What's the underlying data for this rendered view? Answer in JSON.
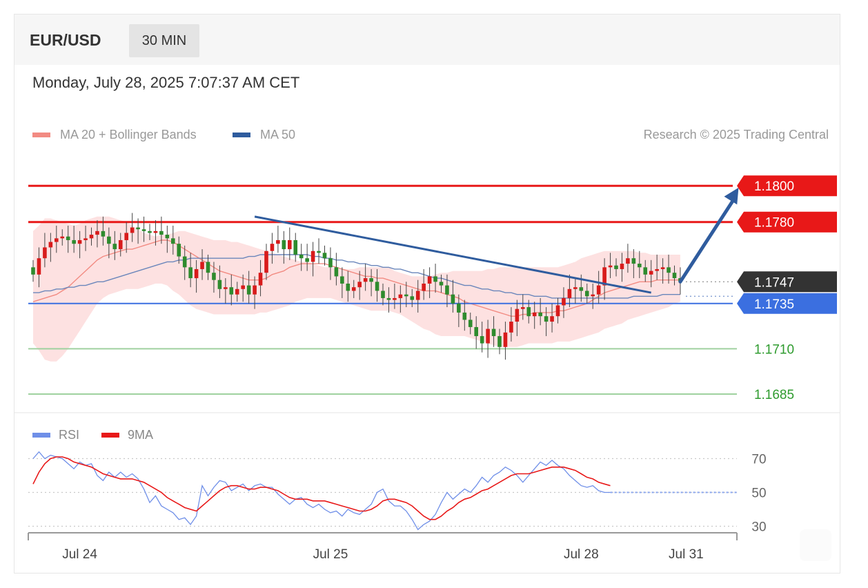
{
  "header": {
    "symbol": "EUR/USD",
    "timeframe": "30 MIN"
  },
  "datetime": "Monday, July 28, 2025 7:07:37 AM CET",
  "legend": {
    "items": [
      {
        "label": "MA 20 + Bollinger Bands",
        "color": "#f28b82"
      },
      {
        "label": "MA 50",
        "color": "#2f5c9e"
      }
    ],
    "copyright": "Research © 2025 Trading Central"
  },
  "rsi_legend": {
    "items": [
      {
        "label": "RSI",
        "color": "#6f8fe8"
      },
      {
        "label": "9MA",
        "color": "#e81818"
      }
    ]
  },
  "colors": {
    "up": "#d81b1b",
    "down": "#2e8b2e",
    "resistance": "#e81818",
    "support": "#3b6fe0",
    "target": "#2f5c9e",
    "current": "#333333"
  },
  "chart_data": [
    {
      "type": "candlestick",
      "title": "EUR/USD",
      "ylim": [
        1.1677,
        1.1818
      ],
      "levels": [
        {
          "label": "1.1800",
          "value": 1.18,
          "kind": "resistance"
        },
        {
          "label": "1.1780",
          "value": 1.178,
          "kind": "resistance"
        },
        {
          "label": "1.1747",
          "value": 1.1747,
          "kind": "current"
        },
        {
          "label": "1.1735",
          "value": 1.1735,
          "kind": "pivot"
        },
        {
          "label": "1.1710",
          "value": 1.171,
          "kind": "support"
        },
        {
          "label": "1.1685",
          "value": 1.1685,
          "kind": "support"
        }
      ],
      "x_ticks": [
        {
          "label": "Jul 24",
          "index": 8
        },
        {
          "label": "Jul 25",
          "index": 51
        },
        {
          "label": "Jul 28",
          "index": 94
        },
        {
          "label": "Jul 31",
          "index": 112
        }
      ],
      "closes": [
        1.1751,
        1.176,
        1.1766,
        1.1769,
        1.1771,
        1.1772,
        1.177,
        1.1768,
        1.177,
        1.1771,
        1.1773,
        1.1775,
        1.1772,
        1.1768,
        1.1765,
        1.177,
        1.1774,
        1.1777,
        1.1776,
        1.1775,
        1.1774,
        1.1775,
        1.1773,
        1.1771,
        1.1768,
        1.1761,
        1.1755,
        1.1749,
        1.1754,
        1.1758,
        1.1752,
        1.1748,
        1.1743,
        1.1744,
        1.174,
        1.1743,
        1.1745,
        1.174,
        1.1745,
        1.1752,
        1.1764,
        1.1768,
        1.177,
        1.1765,
        1.177,
        1.1762,
        1.176,
        1.1758,
        1.1764,
        1.1763,
        1.176,
        1.1755,
        1.175,
        1.1746,
        1.1742,
        1.1744,
        1.1747,
        1.1749,
        1.1747,
        1.1742,
        1.1738,
        1.1737,
        1.1738,
        1.174,
        1.1739,
        1.1737,
        1.1742,
        1.1746,
        1.175,
        1.1747,
        1.1745,
        1.174,
        1.1735,
        1.173,
        1.1726,
        1.1722,
        1.1717,
        1.1713,
        1.1721,
        1.1717,
        1.1711,
        1.1719,
        1.1725,
        1.1732,
        1.1733,
        1.1728,
        1.173,
        1.1728,
        1.1725,
        1.1728,
        1.1734,
        1.1738,
        1.1743,
        1.1744,
        1.1742,
        1.1739,
        1.174,
        1.1745,
        1.1755,
        1.1756,
        1.1754,
        1.1757,
        1.176,
        1.1757,
        1.1755,
        1.1751,
        1.1753,
        1.1754,
        1.1755,
        1.1752,
        1.1749,
        1.1747
      ],
      "ma20_upper": [
        1.1775,
        1.1778,
        1.1782,
        1.1782,
        1.1781,
        1.178,
        1.1779,
        1.1778,
        1.1779,
        1.1781,
        1.1782,
        1.1783,
        1.1783,
        1.1783,
        1.1782,
        1.1781,
        1.178,
        1.1778,
        1.1776,
        1.1774,
        1.1773,
        1.1772,
        1.1773,
        1.1773,
        1.1774,
        1.1775,
        1.1775,
        1.1774,
        1.1773,
        1.1772,
        1.1771,
        1.177,
        1.177,
        1.177,
        1.1769,
        1.1769,
        1.1768,
        1.1767,
        1.1766,
        1.1765,
        1.1764,
        1.1763,
        1.1762,
        1.1761,
        1.176,
        1.1759,
        1.1758,
        1.1758,
        1.1757,
        1.1756,
        1.1755,
        1.1755,
        1.1754,
        1.1754,
        1.1754,
        1.1754,
        1.1755,
        1.1755,
        1.1755,
        1.1755,
        1.1755,
        1.1755,
        1.1753,
        1.1752,
        1.1751,
        1.175,
        1.175,
        1.175,
        1.175,
        1.1751,
        1.1752,
        1.1752,
        1.1753,
        1.1753,
        1.1753,
        1.1753,
        1.1753,
        1.1753,
        1.1754,
        1.1754,
        1.1755,
        1.1755,
        1.1755,
        1.1755,
        1.1755,
        1.1755,
        1.1755,
        1.1755,
        1.1755,
        1.1755,
        1.1755,
        1.1756,
        1.1757,
        1.1758,
        1.176,
        1.1761,
        1.1762,
        1.1763,
        1.1764,
        1.1764,
        1.1764,
        1.1764,
        1.1764,
        1.1764,
        1.1763,
        1.1763,
        1.1762,
        1.1762,
        1.1762,
        1.1762,
        1.1762,
        1.1762
      ],
      "ma20_lower": [
        1.1713,
        1.1709,
        1.1704,
        1.1703,
        1.1703,
        1.1706,
        1.171,
        1.1715,
        1.172,
        1.1725,
        1.173,
        1.1735,
        1.1738,
        1.174,
        1.1741,
        1.1742,
        1.1743,
        1.1743,
        1.1743,
        1.1744,
        1.1745,
        1.1746,
        1.1746,
        1.1745,
        1.1742,
        1.174,
        1.1737,
        1.1734,
        1.1732,
        1.1731,
        1.173,
        1.1729,
        1.1729,
        1.1729,
        1.1729,
        1.1729,
        1.1729,
        1.1729,
        1.1729,
        1.173,
        1.173,
        1.1731,
        1.1732,
        1.1733,
        1.1734,
        1.1736,
        1.1737,
        1.1738,
        1.1738,
        1.1738,
        1.1738,
        1.1738,
        1.1737,
        1.1736,
        1.1735,
        1.1734,
        1.1733,
        1.1732,
        1.1731,
        1.1731,
        1.1731,
        1.1731,
        1.173,
        1.1729,
        1.1727,
        1.1725,
        1.1723,
        1.1721,
        1.172,
        1.1718,
        1.1717,
        1.1717,
        1.1717,
        1.1717,
        1.1717,
        1.1716,
        1.1715,
        1.1714,
        1.1713,
        1.1712,
        1.1711,
        1.1711,
        1.1711,
        1.1711,
        1.1712,
        1.1713,
        1.1713,
        1.1713,
        1.1713,
        1.1713,
        1.1714,
        1.1714,
        1.1714,
        1.1715,
        1.1716,
        1.1717,
        1.1718,
        1.1719,
        1.1721,
        1.1722,
        1.1723,
        1.1724,
        1.1726,
        1.1727,
        1.1728,
        1.1729,
        1.173,
        1.1731,
        1.1732,
        1.1733,
        1.1735,
        1.1736
      ],
      "ma20": [
        1.1736,
        1.1737,
        1.1738,
        1.1739,
        1.174,
        1.1742,
        1.1744,
        1.1747,
        1.175,
        1.1753,
        1.1756,
        1.1759,
        1.1761,
        1.1762,
        1.1763,
        1.1764,
        1.1765,
        1.1765,
        1.1766,
        1.1767,
        1.1768,
        1.1769,
        1.177,
        1.177,
        1.1769,
        1.1767,
        1.1765,
        1.1763,
        1.1761,
        1.1759,
        1.1757,
        1.1755,
        1.1753,
        1.1752,
        1.1751,
        1.175,
        1.1749,
        1.1748,
        1.1748,
        1.1748,
        1.1749,
        1.1751,
        1.1752,
        1.1753,
        1.1755,
        1.1756,
        1.1757,
        1.1757,
        1.1757,
        1.1757,
        1.1757,
        1.1756,
        1.1755,
        1.1754,
        1.1753,
        1.1752,
        1.1751,
        1.175,
        1.175,
        1.1749,
        1.1749,
        1.1748,
        1.1747,
        1.1746,
        1.1745,
        1.1744,
        1.1743,
        1.1742,
        1.1742,
        1.1742,
        1.1741,
        1.174,
        1.1739,
        1.1738,
        1.1736,
        1.1735,
        1.1734,
        1.1733,
        1.1732,
        1.1731,
        1.173,
        1.1729,
        1.1728,
        1.1728,
        1.1729,
        1.1729,
        1.173,
        1.173,
        1.173,
        1.173,
        1.1731,
        1.1731,
        1.1732,
        1.1733,
        1.1734,
        1.1735,
        1.1737,
        1.1739,
        1.1741,
        1.1742,
        1.1743,
        1.1744,
        1.1745,
        1.1746,
        1.1747,
        1.1747,
        1.1747,
        1.1748,
        1.1748,
        1.1748,
        1.1748,
        1.1748
      ],
      "ma50": [
        1.1741,
        1.1741,
        1.1742,
        1.1742,
        1.1743,
        1.1743,
        1.1744,
        1.1744,
        1.1745,
        1.1745,
        1.1746,
        1.1747,
        1.1747,
        1.1748,
        1.1749,
        1.175,
        1.1751,
        1.1752,
        1.1753,
        1.1754,
        1.1755,
        1.1756,
        1.1757,
        1.1758,
        1.1758,
        1.1759,
        1.1759,
        1.176,
        1.176,
        1.176,
        1.176,
        1.176,
        1.176,
        1.176,
        1.176,
        1.176,
        1.176,
        1.1761,
        1.1761,
        1.1762,
        1.1762,
        1.1762,
        1.1762,
        1.1762,
        1.1762,
        1.1762,
        1.1762,
        1.1762,
        1.1761,
        1.1761,
        1.176,
        1.176,
        1.1759,
        1.1759,
        1.1758,
        1.1758,
        1.1757,
        1.1757,
        1.1756,
        1.1756,
        1.1755,
        1.1755,
        1.1754,
        1.1754,
        1.1753,
        1.1752,
        1.1752,
        1.1751,
        1.175,
        1.1749,
        1.1749,
        1.1748,
        1.1747,
        1.1746,
        1.1745,
        1.1745,
        1.1744,
        1.1743,
        1.1743,
        1.1742,
        1.1742,
        1.1741,
        1.1741,
        1.174,
        1.174,
        1.174,
        1.1739,
        1.1739,
        1.1739,
        1.1738,
        1.1738,
        1.1738,
        1.1738,
        1.1738,
        1.1738,
        1.1738,
        1.1738,
        1.1738,
        1.1738,
        1.1738,
        1.1738,
        1.1738,
        1.1738,
        1.1739,
        1.1739,
        1.1739,
        1.1739,
        1.1739,
        1.174,
        1.174,
        1.174,
        1.174
      ],
      "trendline": {
        "from": {
          "index": 38,
          "value": 1.1783
        },
        "to": {
          "index": 106,
          "value": 1.1741
        }
      },
      "target_arrow": {
        "from": {
          "index": 111,
          "value": 1.1747
        },
        "to": {
          "index": 121,
          "value": 1.1799
        }
      }
    },
    {
      "type": "line",
      "title": "RSI",
      "ylim": [
        20,
        80
      ],
      "y_ticks": [
        70,
        50,
        30
      ],
      "series": [
        {
          "name": "RSI",
          "values": [
            70,
            74,
            70,
            72,
            71,
            70,
            67,
            64,
            68,
            66,
            67,
            60,
            57,
            62,
            59,
            62,
            59,
            61,
            58,
            52,
            44,
            48,
            42,
            40,
            38,
            34,
            35,
            31,
            36,
            54,
            48,
            53,
            57,
            56,
            51,
            53,
            55,
            51,
            54,
            55,
            53,
            53,
            49,
            46,
            43,
            46,
            47,
            43,
            41,
            43,
            40,
            38,
            39,
            36,
            40,
            38,
            37,
            40,
            43,
            50,
            52,
            45,
            42,
            42,
            39,
            34,
            28,
            31,
            33,
            37,
            44,
            50,
            46,
            49,
            52,
            50,
            54,
            59,
            56,
            60,
            62,
            65,
            63,
            60,
            56,
            60,
            64,
            68,
            66,
            69,
            66,
            64,
            60,
            57,
            54,
            53,
            54,
            51,
            50,
            50
          ]
        },
        {
          "name": "9MA",
          "values": [
            55,
            62,
            67,
            70,
            71,
            71,
            70,
            68,
            67,
            66,
            65,
            63,
            61,
            60,
            59,
            58,
            58,
            58,
            57,
            56,
            54,
            52,
            50,
            47,
            45,
            43,
            41,
            40,
            39,
            42,
            45,
            48,
            51,
            53,
            54,
            54,
            53,
            52,
            52,
            53,
            53,
            52,
            51,
            49,
            47,
            46,
            46,
            46,
            45,
            45,
            45,
            44,
            43,
            42,
            41,
            40,
            39,
            39,
            40,
            42,
            45,
            46,
            46,
            45,
            44,
            42,
            39,
            36,
            34,
            34,
            36,
            39,
            41,
            44,
            46,
            47,
            49,
            51,
            52,
            54,
            56,
            58,
            60,
            61,
            61,
            61,
            62,
            63,
            64,
            65,
            65,
            65,
            64,
            63,
            61,
            59,
            58,
            56,
            55,
            54
          ]
        }
      ]
    }
  ]
}
